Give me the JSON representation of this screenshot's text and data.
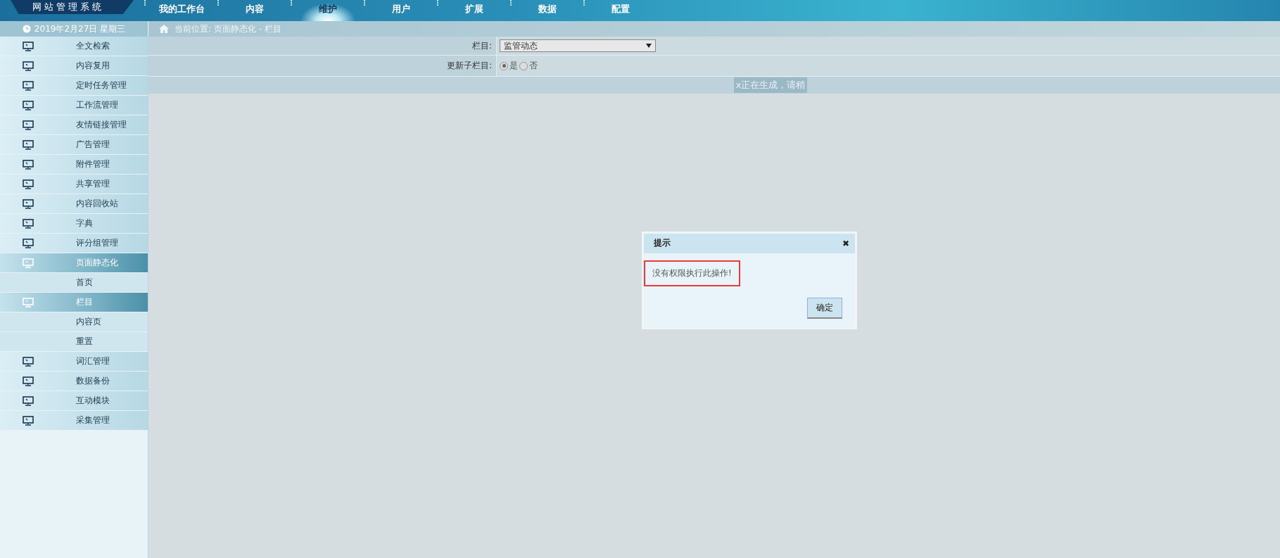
{
  "logo": "网 站 管 理 系 统",
  "nav": [
    {
      "label": "我的工作台",
      "selected": false
    },
    {
      "label": "内容",
      "selected": false
    },
    {
      "label": "维护",
      "selected": true
    },
    {
      "label": "用户",
      "selected": false
    },
    {
      "label": "扩展",
      "selected": false
    },
    {
      "label": "数据",
      "selected": false
    },
    {
      "label": "配置",
      "selected": false
    }
  ],
  "date": "2019年2月27日 星期三",
  "breadcrumb": "当前位置: 页面静态化 - 栏目",
  "sidebar": {
    "items": [
      {
        "kind": "menu",
        "label": "全文检索",
        "selected": false
      },
      {
        "kind": "menu",
        "label": "内容复用",
        "selected": false
      },
      {
        "kind": "menu",
        "label": "定时任务管理",
        "selected": false
      },
      {
        "kind": "menu",
        "label": "工作流管理",
        "selected": false
      },
      {
        "kind": "menu",
        "label": "友情链接管理",
        "selected": false
      },
      {
        "kind": "menu",
        "label": "广告管理",
        "selected": false
      },
      {
        "kind": "menu",
        "label": "附件管理",
        "selected": false
      },
      {
        "kind": "menu",
        "label": "共享管理",
        "selected": false
      },
      {
        "kind": "menu",
        "label": "内容回收站",
        "selected": false
      },
      {
        "kind": "menu",
        "label": "字典",
        "selected": false
      },
      {
        "kind": "menu",
        "label": "评分组管理",
        "selected": false
      },
      {
        "kind": "menu",
        "label": "页面静态化",
        "selected": true
      },
      {
        "kind": "sub",
        "label": "首页",
        "selected": false
      },
      {
        "kind": "menu",
        "label": "栏目",
        "selected": true
      },
      {
        "kind": "sub",
        "label": "内容页",
        "selected": false
      },
      {
        "kind": "sub",
        "label": "重置",
        "selected": false
      },
      {
        "kind": "menu",
        "label": "词汇管理",
        "selected": false
      },
      {
        "kind": "menu",
        "label": "数据备份",
        "selected": false
      },
      {
        "kind": "menu",
        "label": "互动模块",
        "selected": false
      },
      {
        "kind": "menu",
        "label": "采集管理",
        "selected": false
      }
    ]
  },
  "form": {
    "column": {
      "label": "栏目:",
      "value": "监管动态"
    },
    "update_children": {
      "label": "更新子栏目:",
      "options": [
        {
          "label": "是",
          "selected": true
        },
        {
          "label": "否",
          "selected": false
        }
      ]
    },
    "progress": "x正在生成，请稍"
  },
  "dialog": {
    "title": "提示",
    "close": "✖",
    "message": "没有权限执行此操作!",
    "button": "确定"
  }
}
